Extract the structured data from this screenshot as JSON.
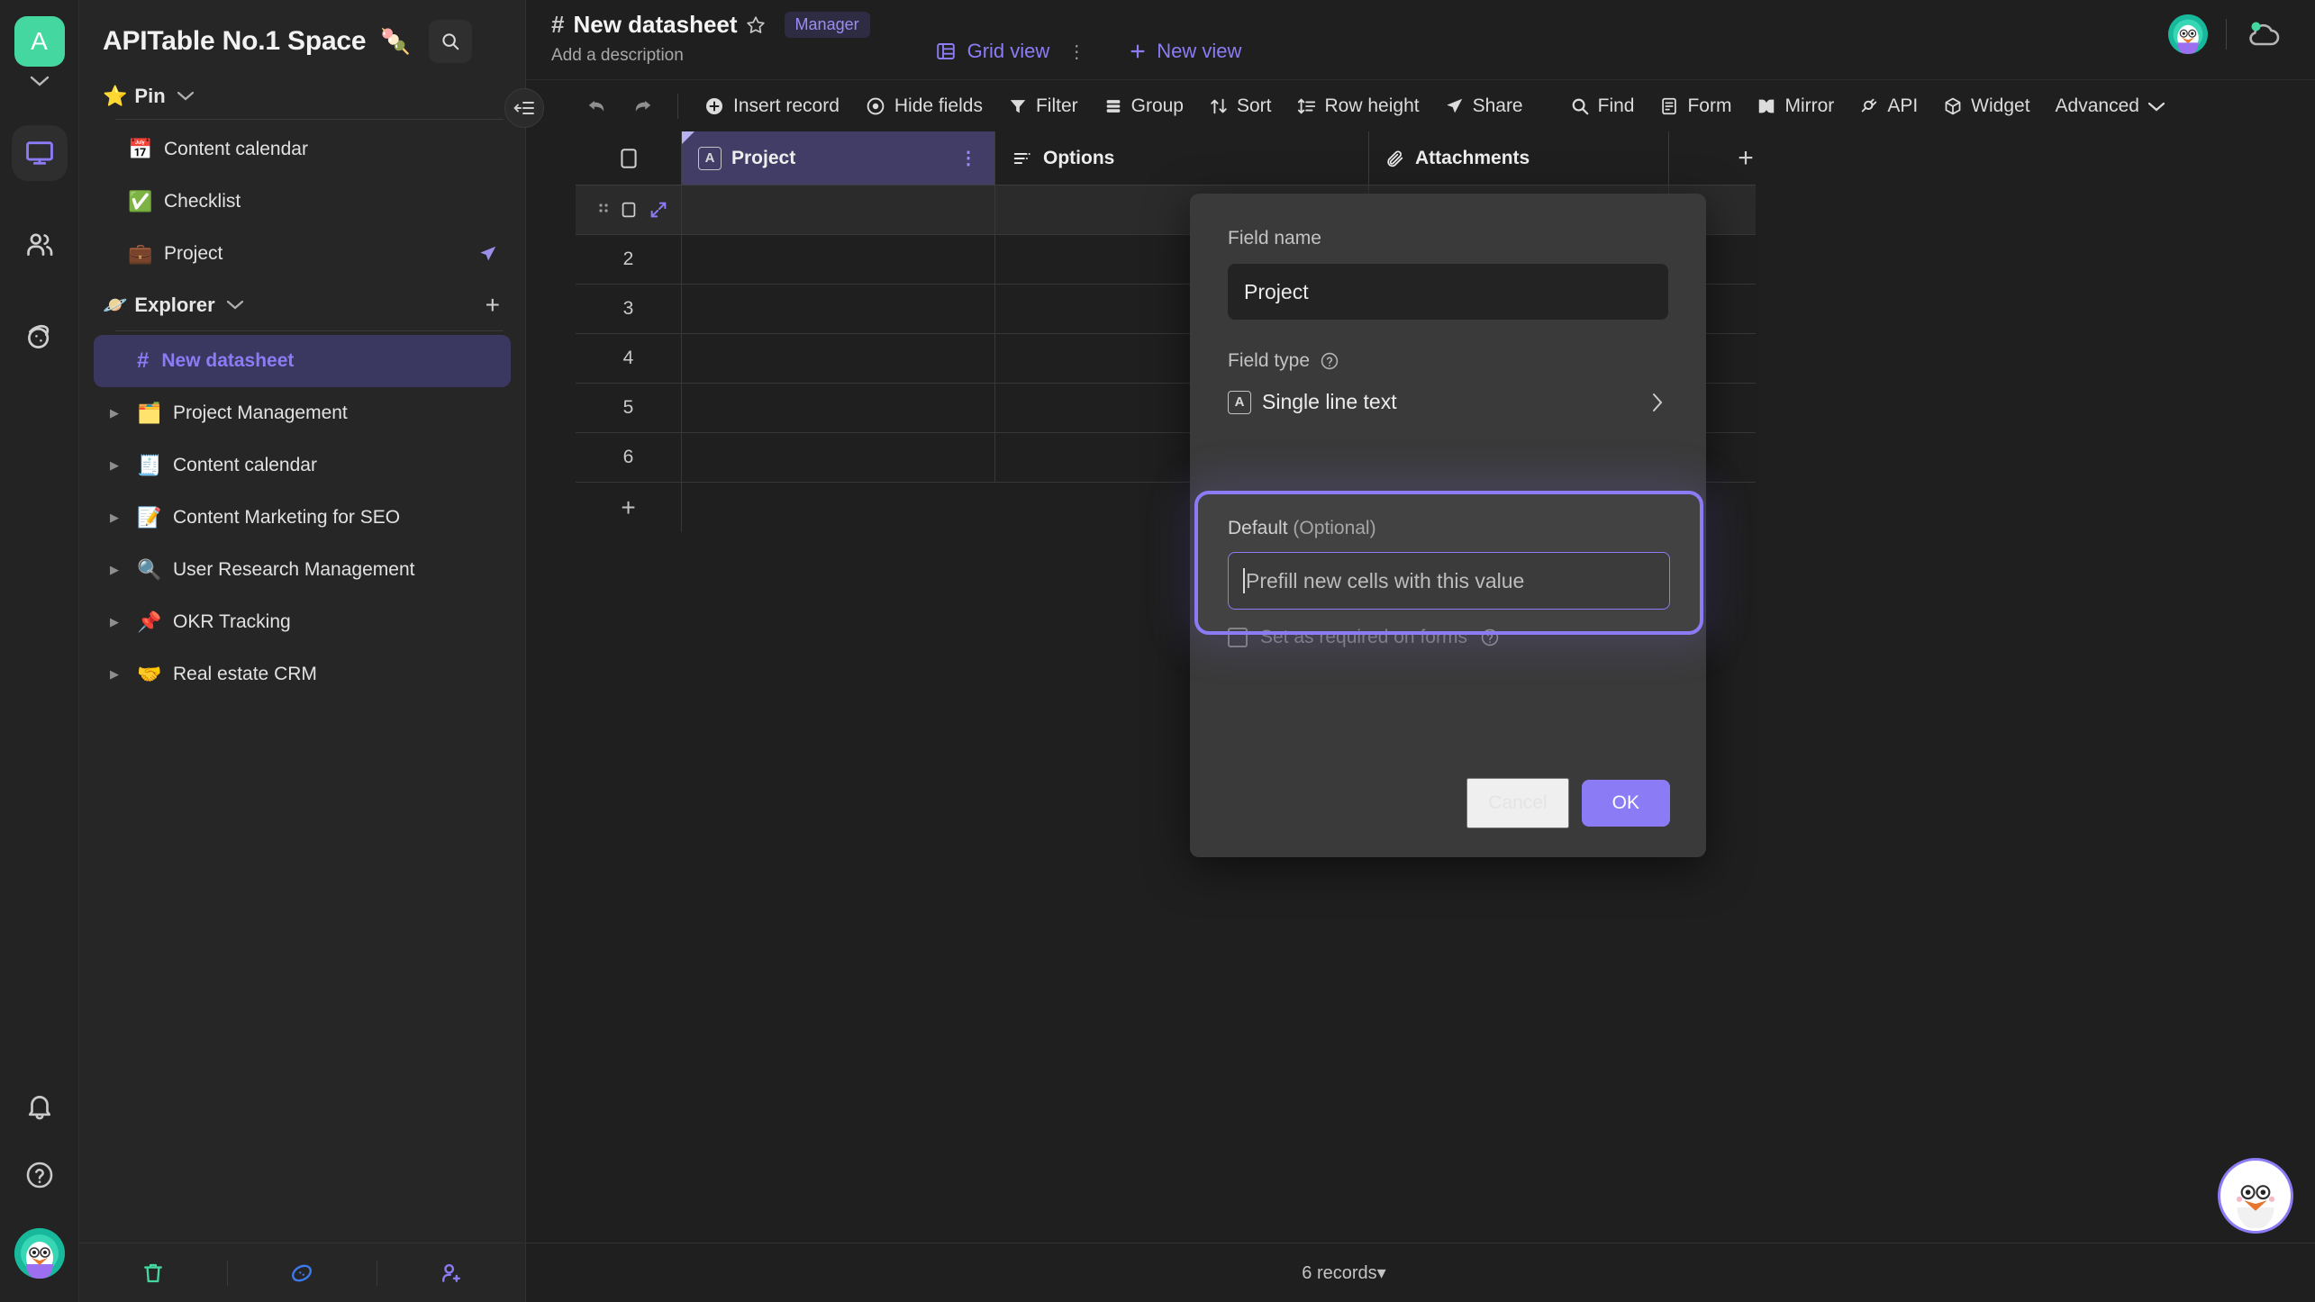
{
  "rail": {
    "workspace_initial": "A",
    "items": [
      {
        "name": "workbench-icon",
        "label": "Workbench",
        "active": true
      },
      {
        "name": "members-icon",
        "label": "Members",
        "active": false
      },
      {
        "name": "space-icon",
        "label": "Space",
        "active": false
      }
    ],
    "bottom": [
      {
        "name": "notification-bell-icon",
        "label": "Notifications"
      },
      {
        "name": "help-circle-icon",
        "label": "Help"
      }
    ],
    "user_avatar_emoji": "🐦"
  },
  "sidebar": {
    "space_name": "APITable No.1 Space",
    "space_emoji": "🍡",
    "search_icon": "search-icon",
    "pin": {
      "emoji": "⭐",
      "label": "Pin",
      "items": [
        {
          "emoji": "📅",
          "label": "Content calendar"
        },
        {
          "emoji": "✅",
          "label": "Checklist"
        },
        {
          "emoji": "💼",
          "label": "Project",
          "trailing_icon": "send-icon"
        }
      ]
    },
    "explorer": {
      "emoji": "🪐",
      "label": "Explorer",
      "add_label": "+",
      "items": [
        {
          "icon": "hash",
          "label": "New datasheet",
          "selected": true
        },
        {
          "emoji": "🗂️",
          "label": "Project Management",
          "expandable": true
        },
        {
          "emoji": "🧾",
          "label": "Content calendar",
          "expandable": true
        },
        {
          "emoji": "📝",
          "label": "Content Marketing for SEO",
          "expandable": true
        },
        {
          "emoji": "🔍",
          "label": "User Research Management",
          "expandable": true
        },
        {
          "emoji": "📌",
          "label": "OKR Tracking",
          "expandable": true
        },
        {
          "emoji": "🤝",
          "label": "Real estate CRM",
          "expandable": true
        }
      ]
    },
    "footer_icons": [
      {
        "name": "trash-icon",
        "label": "Trash"
      },
      {
        "name": "template-icon",
        "label": "Template center"
      },
      {
        "name": "invite-member-icon",
        "label": "Invite member"
      }
    ]
  },
  "header": {
    "hash": "#",
    "datasheet_title": "New datasheet",
    "star_icon": "star-outline-icon",
    "role_badge": "Manager",
    "description_placeholder": "Add a description",
    "tabs": [
      {
        "label": "Grid view",
        "icon": "grid-view-icon",
        "active": true
      }
    ],
    "new_view_label": "New view",
    "right_icons": [
      {
        "name": "user-avatar",
        "label": "User avatar"
      },
      {
        "name": "cloud-sync-icon",
        "label": "Cloud sync"
      }
    ]
  },
  "toolbar": {
    "collapse_icon": "collapse-sidebar-icon",
    "undo_icon": "undo-icon",
    "redo_icon": "redo-icon",
    "left_items": [
      {
        "label": "Insert record",
        "icon": "plus-circle-icon"
      },
      {
        "label": "Hide fields",
        "icon": "eye-icon"
      },
      {
        "label": "Filter",
        "icon": "filter-icon"
      },
      {
        "label": "Group",
        "icon": "group-icon"
      },
      {
        "label": "Sort",
        "icon": "sort-icon"
      },
      {
        "label": "Row height",
        "icon": "row-height-icon"
      },
      {
        "label": "Share",
        "icon": "share-icon"
      }
    ],
    "right_items": [
      {
        "label": "Find",
        "icon": "search-icon"
      },
      {
        "label": "Form",
        "icon": "form-icon"
      },
      {
        "label": "Mirror",
        "icon": "mirror-icon"
      },
      {
        "label": "API",
        "icon": "api-plug-icon"
      },
      {
        "label": "Widget",
        "icon": "widget-cube-icon"
      },
      {
        "label": "Advanced",
        "icon": "chevron-down-icon"
      }
    ]
  },
  "grid": {
    "columns": [
      {
        "label": "Project",
        "type_icon": "single-line-text-icon",
        "primary": true
      },
      {
        "label": "Options",
        "type_icon": "options-icon",
        "primary": false
      },
      {
        "label": "Attachments",
        "type_icon": "attachment-icon",
        "primary": false
      }
    ],
    "add_field_label": "+",
    "rows": [
      {
        "index": "",
        "first": true
      },
      {
        "index": "2"
      },
      {
        "index": "3"
      },
      {
        "index": "4"
      },
      {
        "index": "5"
      },
      {
        "index": "6"
      }
    ],
    "add_row_label": "+",
    "record_count_label": "6 records",
    "record_count_caret": "▾"
  },
  "modal": {
    "field_name_label": "Field name",
    "field_name_value": "Project",
    "field_type_label": "Field type",
    "field_type_help_icon": "help-circle-icon",
    "field_type_value": "Single line text",
    "field_type_badge": "A",
    "field_type_chevron": "›",
    "default_label": "Default",
    "default_optional": "(Optional)",
    "default_placeholder": "Prefill new cells with this value",
    "required_checkbox_label": "Set as required on forms",
    "required_help_icon": "help-circle-icon",
    "cancel_label": "Cancel",
    "ok_label": "OK"
  },
  "bot": {
    "emoji": "🦉",
    "name": "assistant-bot"
  },
  "colors": {
    "accent": "#8b7cf6",
    "primary_col": "#413d66",
    "bg": "#1f1f1f",
    "sidebar_bg": "#262626",
    "modal_bg": "#3a3a3a",
    "avatar_green": "#44d7a0"
  }
}
